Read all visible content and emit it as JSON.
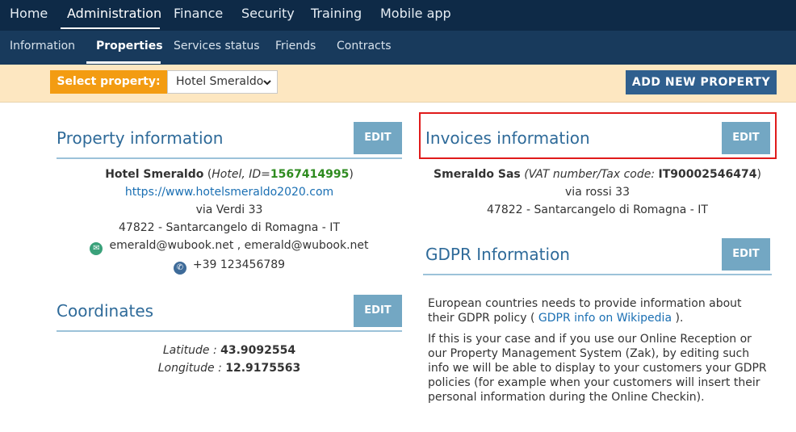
{
  "top_nav": {
    "items": [
      {
        "label": "Home"
      },
      {
        "label": "Administration"
      },
      {
        "label": "Finance"
      },
      {
        "label": "Security"
      },
      {
        "label": "Training"
      },
      {
        "label": "Mobile app"
      }
    ],
    "active": "Administration"
  },
  "sub_nav": {
    "items": [
      {
        "label": "Information"
      },
      {
        "label": "Properties"
      },
      {
        "label": "Services status"
      },
      {
        "label": "Friends"
      },
      {
        "label": "Contracts"
      }
    ],
    "active": "Properties"
  },
  "property_selector": {
    "label": "Select property:",
    "value": "Hotel Smeraldo",
    "add_button": "ADD NEW PROPERTY"
  },
  "property_info": {
    "title": "Property information",
    "edit": "EDIT",
    "name": "Hotel Smeraldo",
    "type_prefix": "(",
    "type": "Hotel, ID=",
    "id": "1567414995",
    "type_suffix": ")",
    "website": "https://www.hotelsmeraldo2020.com",
    "address": "via Verdi 33",
    "city_line": "47822 - Santarcangelo di Romagna - IT",
    "emails": "emerald@wubook.net , emerald@wubook.net",
    "phone": "+39 123456789"
  },
  "coordinates": {
    "title": "Coordinates",
    "edit": "EDIT",
    "latitude_label": "Latitude :",
    "latitude": "43.9092554",
    "longitude_label": "Longitude :",
    "longitude": "12.9175563"
  },
  "invoices_info": {
    "title": "Invoices information",
    "edit": "EDIT",
    "company": "Smeraldo Sas",
    "vat_label": "(VAT number/Tax code:",
    "vat": "IT90002546474",
    "vat_close": ")",
    "address": "via rossi 33",
    "city_line": "47822 - Santarcangelo di Romagna - IT"
  },
  "gdpr_info": {
    "title": "GDPR Information",
    "edit": "EDIT",
    "para1_a": "European countries needs to provide information about their GDPR policy (",
    "para1_link": "GDPR info on Wikipedia",
    "para1_b": ").",
    "para2": "If this is your case and if you use our Online Reception or our Property Management System (Zak), by editing such info we will be able to display to your customers your GDPR policies (for example when your customers will insert their personal information during the Online Checkin)."
  },
  "colors": {
    "nav_bg": "#0e2a47",
    "subnav_bg": "#183a5c",
    "select_bar_bg": "#fde7c1",
    "select_label_bg": "#f39c12",
    "section_title": "#2e6a99",
    "edit_button": "#73a7c3",
    "highlight": "#e01b1b"
  },
  "icons": {
    "email": "email-icon",
    "phone": "phone-icon",
    "chevron": "chevron-down-icon"
  }
}
